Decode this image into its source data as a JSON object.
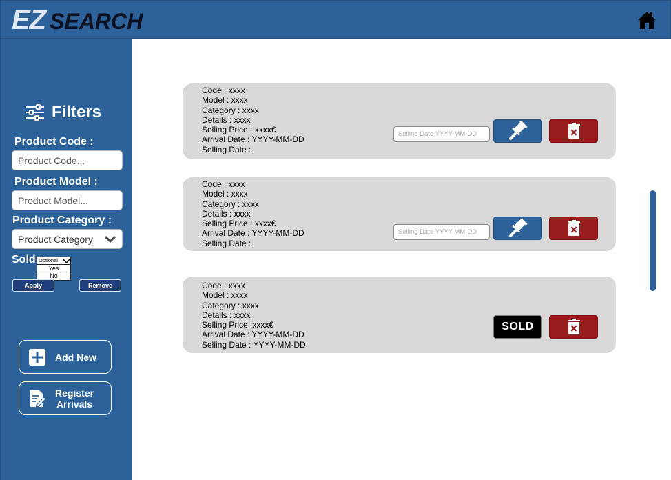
{
  "header": {
    "logo_ez": "EZ",
    "logo_search": "SEARCH",
    "home_icon": "home-icon"
  },
  "colors": {
    "primary": "#2c6299",
    "danger": "#981d1d",
    "sold": "#000000",
    "card": "#d9d9d9",
    "button_dark": "#1e3e7c"
  },
  "sidebar": {
    "title": "Filters",
    "title_icon": "sliders-icon",
    "product_code": {
      "label": "Product Code :",
      "placeholder": "Product Code..."
    },
    "product_model": {
      "label": "Product Model :",
      "placeholder": "Product Model..."
    },
    "product_category": {
      "label": "Product Category :",
      "value": "Product Category"
    },
    "sold": {
      "label": "Sold",
      "selected": "Optional",
      "options": [
        "Yes",
        "No"
      ]
    },
    "apply_label": "Apply",
    "remove_label": "Remove",
    "add_new_label": "Add New",
    "register_label_1": "Register",
    "register_label_2": "Arrivals"
  },
  "products": [
    {
      "code": "Code : xxxx",
      "model": "Model : xxxx",
      "category": "Category : xxxx",
      "details": "Details : xxxx",
      "price": "Selling Price : xxxx€",
      "arrival": "Arrival Date : YYYY-MM-DD",
      "selling": "Selling Date :",
      "date_placeholder": "Selling Date YYYY-MM-DD",
      "status": "available"
    },
    {
      "code": "Code : xxxx",
      "model": "Model : xxxx",
      "category": "Category : xxxx",
      "details": "Details : xxxx",
      "price": "Selling Price : xxxx€",
      "arrival": "Arrival Date : YYYY-MM-DD",
      "selling": "Selling Date :",
      "date_placeholder": "Selling Date YYYY-MM-DD",
      "status": "available"
    },
    {
      "code": "Code : xxxx",
      "model": "Model : xxxx",
      "category": "Category : xxxx",
      "details": "Details : xxxx",
      "price": "Selling Price :xxxx€",
      "arrival": "Arrival Date : YYYY-MM-DD",
      "selling": "Selling Date : YYYY-MM-DD",
      "sold_label": "SOLD",
      "status": "sold"
    }
  ]
}
